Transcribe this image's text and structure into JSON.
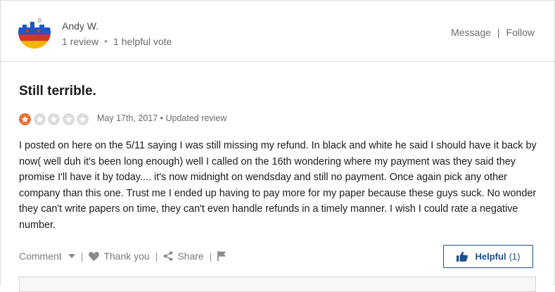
{
  "user": {
    "name": "Andy W.",
    "review_count": "1 review",
    "helpful_votes": "1 helpful vote",
    "separator": "•"
  },
  "header_actions": {
    "message_label": "Message",
    "separator": "|",
    "follow_label": "Follow"
  },
  "review": {
    "title": "Still terrible.",
    "rating": 1,
    "rating_max": 5,
    "date": "May 17th, 2017 • Updated review",
    "body": "I posted on here on the 5/11 saying I was still missing my refund. In black and white he said I should have it back by now( well duh it's been long enough) well I called on the 16th wondering where my payment was they said they promise I'll have it by today.... it's now midnight on wendsday and still no payment. Once again pick any other company than this one. Trust me I ended up having to pay more for my paper because these guys suck. No wonder they can't write papers on time, they can't even handle refunds in a timely manner. I wish I could rate a negative number."
  },
  "actions": {
    "comment_label": "Comment",
    "thank_you_label": "Thank you",
    "share_label": "Share",
    "separator": "|"
  },
  "helpful_button": {
    "label": "Helpful",
    "count": "(1)"
  },
  "colors": {
    "star_filled": "#e96d31",
    "star_empty": "#dcdcdc",
    "accent": "#1b4f8c"
  }
}
